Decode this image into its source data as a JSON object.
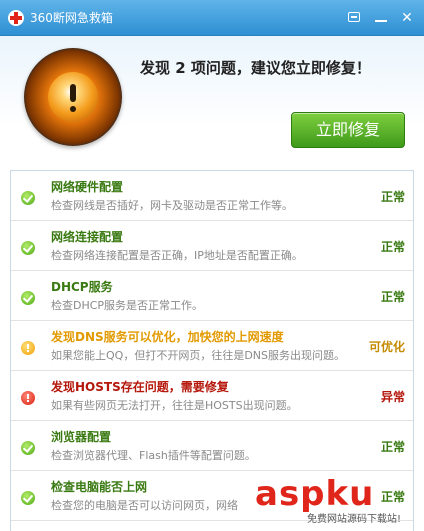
{
  "window": {
    "title": "360断网急救箱"
  },
  "header": {
    "headline": "发现 2 项问题，建议您立即修复！",
    "fix_label": "立即修复"
  },
  "items": [
    {
      "title": "网络硬件配置",
      "desc": "检查网线是否插好，网卡及驱动是否正常工作等。",
      "status": "正常",
      "level": "ok"
    },
    {
      "title": "网络连接配置",
      "desc": "检查网络连接配置是否正确，IP地址是否配置正确。",
      "status": "正常",
      "level": "ok"
    },
    {
      "title": "DHCP服务",
      "desc": "检查DHCP服务是否正常工作。",
      "status": "正常",
      "level": "ok"
    },
    {
      "title": "发现DNS服务可以优化，加快您的上网速度",
      "desc": "如果您能上QQ，但打不开网页，往往是DNS服务出现问题。",
      "status": "可优化",
      "level": "warn"
    },
    {
      "title": "发现HOSTS存在问题，需要修复",
      "desc": "如果有些网页无法打开，往往是HOSTS出现问题。",
      "status": "异常",
      "level": "err"
    },
    {
      "title": "浏览器配置",
      "desc": "检查浏览器代理、Flash插件等配置问题。",
      "status": "正常",
      "level": "ok"
    },
    {
      "title": "检查电脑能否上网",
      "desc": "检查您的电脑是否可以访问网页，网络",
      "status": "正常",
      "level": "ok"
    }
  ],
  "watermark": {
    "brand": "aspku",
    "sub": "免费网站源码下载站!"
  },
  "colors": {
    "titlebar": "#2e8fd3",
    "fix_button": "#3e9a1a",
    "ok": "#3a7a12",
    "warn": "#e29a00",
    "err": "#b5170b"
  }
}
